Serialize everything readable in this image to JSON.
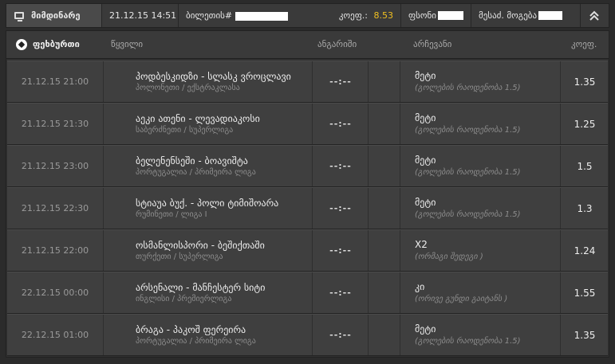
{
  "topbar": {
    "current_label": "მიმდინარე",
    "date": "21.12.15 14:51",
    "ticket_label": "ბილეთის#",
    "coef_label": "კოეფ.:",
    "coef_value": "8.53",
    "money_label": "ფსონი",
    "winnings_label": "მესაძ. მოგება"
  },
  "table": {
    "sport": "ფეხბურთი",
    "headers": {
      "event": "წყვილი",
      "score": "ანგარიში",
      "selection": "არჩევანი",
      "odds": "კოეფ."
    },
    "rows": [
      {
        "datetime": "21.12.15 21:00",
        "event": "პოდბესკიდზი - სლასკ ვროცლავი",
        "league": "პოლონეთი / ექსტრაკლასა",
        "score": "--:--",
        "selection": "მეტი",
        "selection_detail": "(გოლების რაოდენობა 1.5)",
        "odds": "1.35"
      },
      {
        "datetime": "21.12.15 21:30",
        "event": "აეკი ათენი - ლევადიაკოსი",
        "league": "საბერძნეთი / სუპერლიგა",
        "score": "--:--",
        "selection": "მეტი",
        "selection_detail": "(გოლების რაოდენობა 1.5)",
        "odds": "1.25"
      },
      {
        "datetime": "21.12.15 23:00",
        "event": "ბელენენსეში - ბოავიშტა",
        "league": "პორტუგალია / პრიმეირა ლიგა",
        "score": "--:--",
        "selection": "მეტი",
        "selection_detail": "(გოლების რაოდენობა 1.5)",
        "odds": "1.5"
      },
      {
        "datetime": "21.12.15 22:30",
        "event": "სტიაუა ბუქ. - პოლი ტიმიშოარა",
        "league": "რუმინეთი / ლიგა I",
        "score": "--:--",
        "selection": "მეტი",
        "selection_detail": "(გოლების რაოდენობა 1.5)",
        "odds": "1.3"
      },
      {
        "datetime": "21.12.15 22:00",
        "event": "ოსმანლისპორი - ბეშიქთაში",
        "league": "თურქეთი / სუპერლიგა",
        "score": "--:--",
        "selection": "X2",
        "selection_detail": "(ორმაგი შედეგი )",
        "odds": "1.24"
      },
      {
        "datetime": "22.12.15 00:00",
        "event": "არსენალი - მანჩესტერ სიტი",
        "league": "ინგლისი / პრემიერლიგა",
        "score": "--:--",
        "selection": "კი",
        "selection_detail": "(ორივე გუნდი გაიტანს )",
        "odds": "1.55"
      },
      {
        "datetime": "22.12.15 01:00",
        "event": "ბრაგა - პაკოშ ფერეირა",
        "league": "პორტუგალია / პრიმეირა ლიგა",
        "score": "--:--",
        "selection": "მეტი",
        "selection_detail": "(გოლების რაოდენობა 1.5)",
        "odds": "1.35"
      }
    ]
  }
}
